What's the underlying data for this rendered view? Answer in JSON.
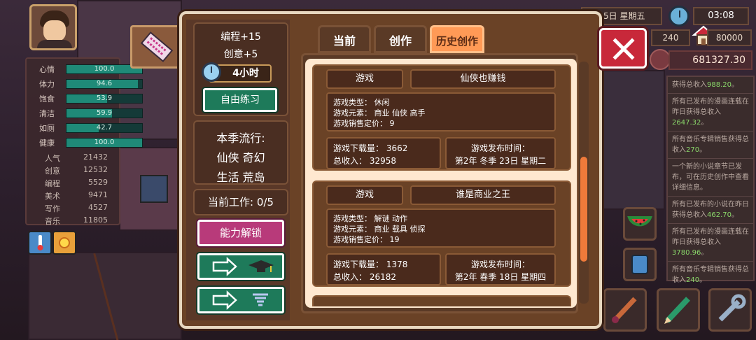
{
  "hud": {
    "bars": [
      {
        "label": "心情",
        "value": "100.0",
        "fill": 1.0
      },
      {
        "label": "体力",
        "value": "94.6",
        "fill": 0.946
      },
      {
        "label": "饱食",
        "value": "53.9",
        "fill": 0.539
      },
      {
        "label": "清洁",
        "value": "59.9",
        "fill": 0.599
      },
      {
        "label": "如厕",
        "value": "42.7",
        "fill": 0.427
      },
      {
        "label": "健康",
        "value": "100.0",
        "fill": 1.0
      }
    ],
    "attributes": [
      {
        "label": "人气",
        "value": "21432"
      },
      {
        "label": "创意",
        "value": "12532"
      },
      {
        "label": "编程",
        "value": "5529"
      },
      {
        "label": "美术",
        "value": "9471"
      },
      {
        "label": "写作",
        "value": "4527"
      },
      {
        "label": "音乐",
        "value": "11805"
      }
    ],
    "date": "5日  星期五",
    "time": "03:08",
    "resource1": "240",
    "resource2": "80000",
    "money": "681327.30"
  },
  "feed": [
    {
      "text": "获得总收入",
      "num": "988.20",
      "tail": "。"
    },
    {
      "text": "所有已发布的漫画连载在昨日获得总收入",
      "num": "2647.32",
      "tail": "。"
    },
    {
      "text": "所有音乐专辑销售获得总收入",
      "num": "270",
      "tail": "。"
    },
    {
      "text": "一个新的小说章节已发布，可在历史创作中查看详细信息。",
      "num": "",
      "tail": ""
    },
    {
      "text": "所有已发布的小说在昨日获得总收入",
      "num": "462.70",
      "tail": "。"
    },
    {
      "text": "所有已发布的漫画连载在昨日获得总收入",
      "num": "3780.96",
      "tail": "。"
    },
    {
      "text": "所有音乐专辑销售获得总收入",
      "num": "240",
      "tail": "。"
    }
  ],
  "panel": {
    "gain1": "编程+15",
    "gain2": "创意+5",
    "duration": "4小时",
    "practice": "自由练习",
    "trend_title": "本季流行:",
    "trend_line1": "仙侠  奇幻",
    "trend_line2": "生活  荒岛",
    "work": "当前工作:  0/5",
    "unlock": "能力解锁"
  },
  "tabs": [
    {
      "label": "当前",
      "active": false
    },
    {
      "label": "创作",
      "active": false
    },
    {
      "label": "历史创作",
      "active": true
    }
  ],
  "entries": [
    {
      "category": "游戏",
      "title": "仙侠也赚钱",
      "type_line": "游戏类型：  休闲",
      "elements_line": "游戏元素：  商业  仙侠  高手",
      "price_line": "游戏销售定价：  9",
      "downloads": "游戏下载量：  3662",
      "income": "总收入：  32958",
      "release_label": "游戏发布时间：",
      "release_date": "第2年  冬季  23日  星期二"
    },
    {
      "category": "游戏",
      "title": "谁是商业之王",
      "type_line": "游戏类型：  解谜  动作",
      "elements_line": "游戏元素：  商业  载具  侦探",
      "price_line": "游戏销售定价：  19",
      "downloads": "游戏下载量：  1378",
      "income": "总收入：  26182",
      "release_label": "游戏发布时间：",
      "release_date": "第2年  春季  18日  星期四"
    }
  ],
  "colors": {
    "active_tab": "#ff9a56",
    "close": "#c8283a",
    "green_button": "#1e7a5a",
    "pink_button": "#b83a7a",
    "highlight": "#8ad86a"
  }
}
